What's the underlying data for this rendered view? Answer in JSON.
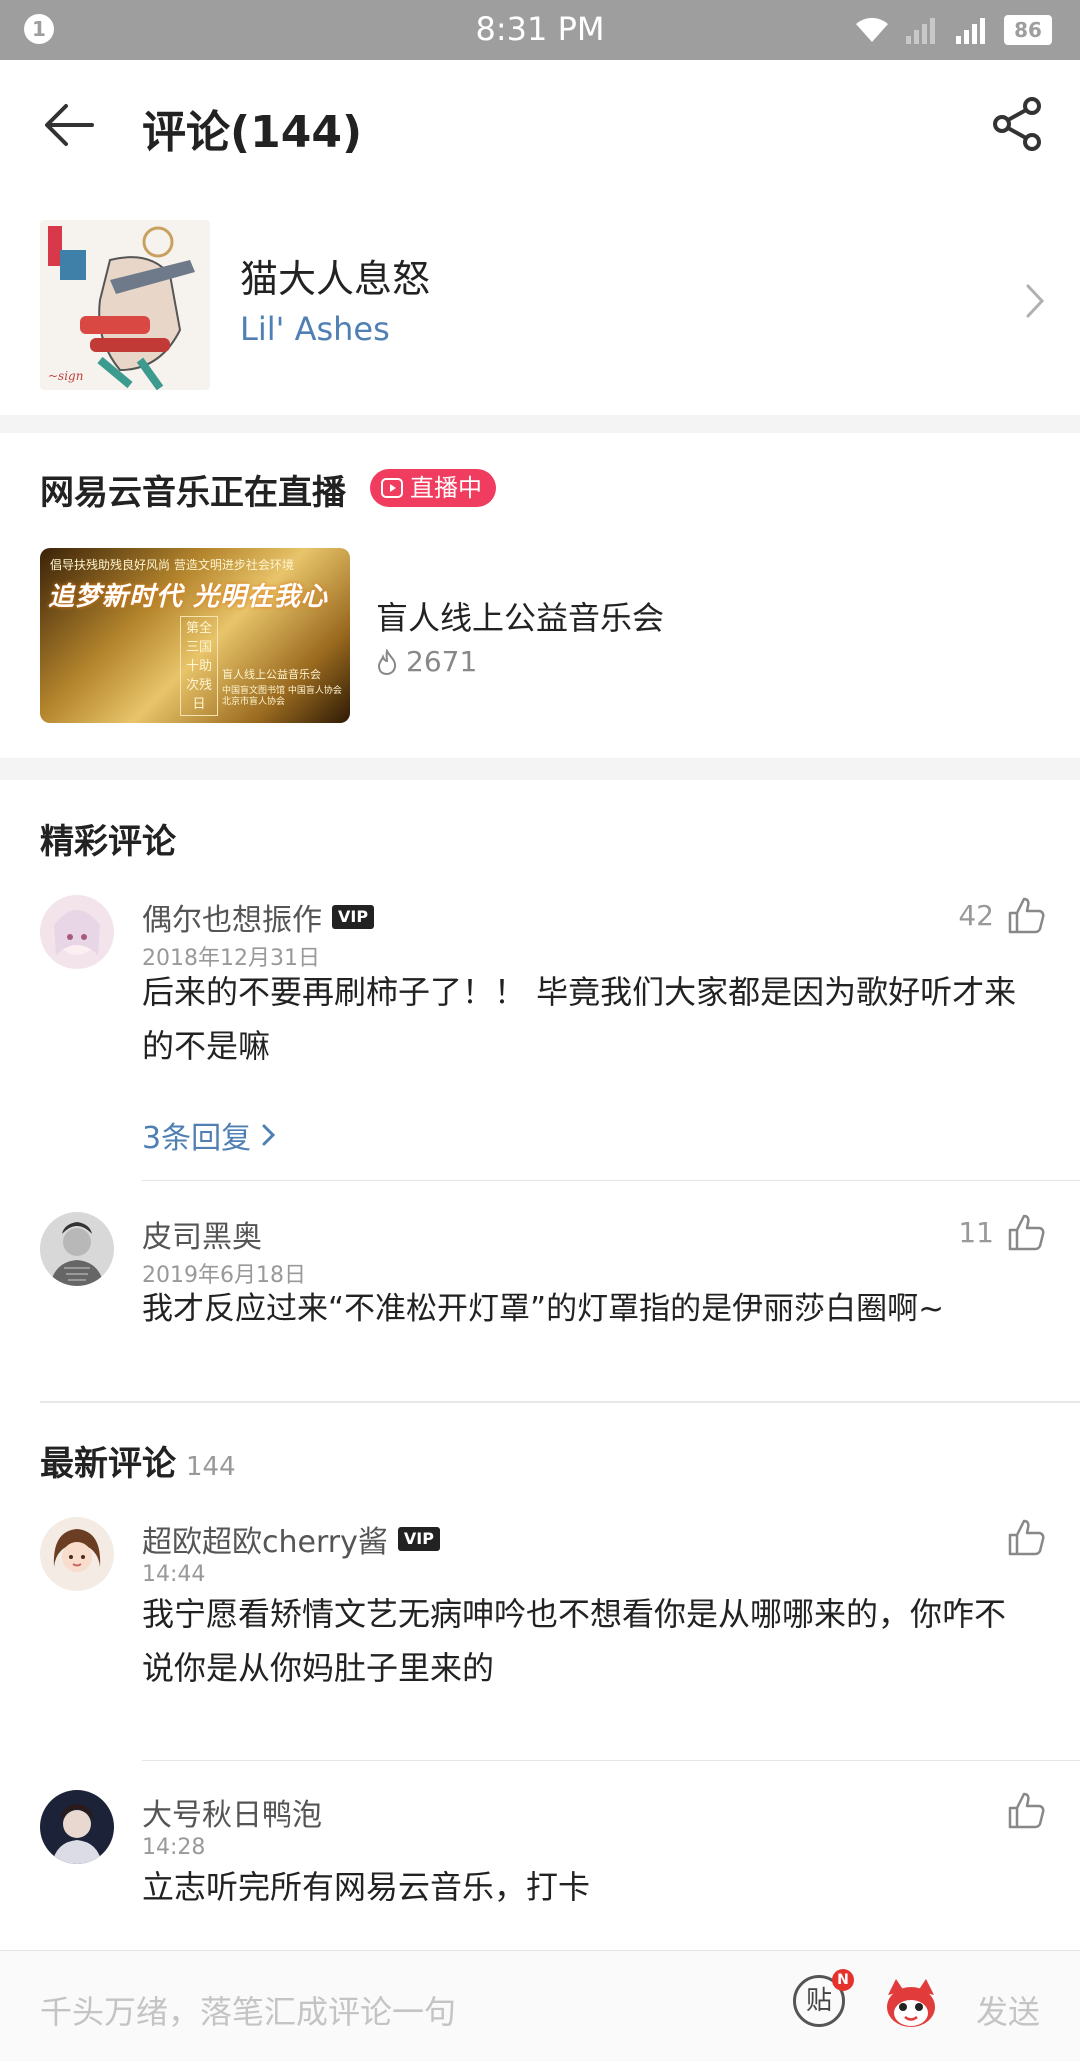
{
  "status_bar": {
    "notification_count": "1",
    "time": "8:31 PM",
    "battery": "86",
    "icons": [
      "wifi-icon",
      "signal-icon",
      "signal-icon"
    ]
  },
  "header": {
    "title": "评论(144)",
    "back_icon": "back-arrow-icon",
    "share_icon": "share-icon"
  },
  "song": {
    "name": "猫大人息怒",
    "artist": "Lil' Ashes"
  },
  "live": {
    "heading": "网易云音乐正在直播",
    "badge": "直播中",
    "thumbnail": {
      "line1": "倡导扶残助残良好风尚  营造文明进步社会环境",
      "line2": "追梦新时代 光明在我心",
      "vertical": "第全三国十助次残日",
      "line3": "盲人线上公益音乐会",
      "line4": "中国盲文图书馆 中国盲人协会 北京市盲人协会"
    },
    "title": "盲人线上公益音乐会",
    "count": "2671"
  },
  "featured": {
    "title": "精彩评论",
    "comments": [
      {
        "user": "偶尔也想振作",
        "vip": "VIP",
        "date": "2018年12月31日",
        "likes": "42",
        "text": "后来的不要再刷柿子了！！ 毕竟我们大家都是因为歌好听才来的不是嘛",
        "replies": "3条回复"
      },
      {
        "user": "皮司黑奥",
        "date": "2019年6月18日",
        "likes": "11",
        "text": "我才反应过来“不准松开灯罩”的灯罩指的是伊丽莎白圈啊~"
      }
    ]
  },
  "latest": {
    "title": "最新评论",
    "count": "144",
    "comments": [
      {
        "user": "超欧超欧cherry酱",
        "vip": "VIP",
        "date": "14:44",
        "text": "我宁愿看矫情文艺无病呻吟也不想看你是从哪哪来的，你咋不说你是从你妈肚子里来的"
      },
      {
        "user": "大号秋日鸭泡",
        "date": "14:28",
        "text": "立志听完所有网易云音乐，打卡"
      }
    ]
  },
  "bottom": {
    "placeholder": "千头万绪，落笔汇成评论一句",
    "tie_label": "贴",
    "tie_badge": "N",
    "send": "发送"
  },
  "colors": {
    "accent_link": "#4f7fb3",
    "live_badge": "#f03c5e",
    "status_bar": "#9e9e9e"
  }
}
